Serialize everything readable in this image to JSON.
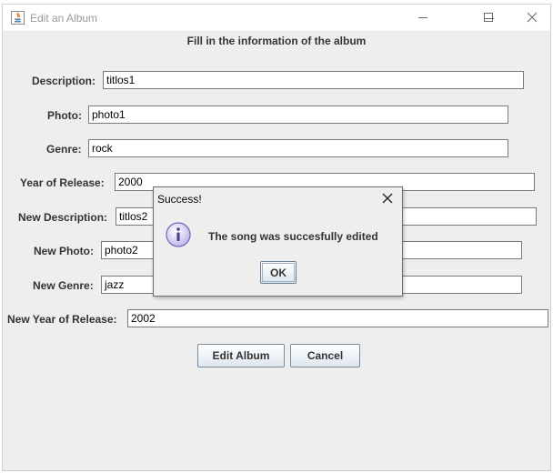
{
  "window": {
    "title": "Edit an Album",
    "controls": [
      "minimize-icon",
      "maximize-icon",
      "close-icon"
    ]
  },
  "form": {
    "heading": "Fill in the information of the album",
    "fields": [
      {
        "label": "Description:",
        "value": "titlos1"
      },
      {
        "label": "Photo:",
        "value": "photo1"
      },
      {
        "label": "Genre:",
        "value": "rock"
      },
      {
        "label": "Year of Release:",
        "value": "2000"
      },
      {
        "label": "New Description:",
        "value": "titlos2"
      },
      {
        "label": "New Photo:",
        "value": "photo2"
      },
      {
        "label": "New Genre:",
        "value": "jazz"
      },
      {
        "label": "New Year of Release:",
        "value": "2002"
      }
    ],
    "buttons": {
      "edit": "Edit Album",
      "cancel": "Cancel"
    }
  },
  "dialog": {
    "title": "Success!",
    "message": "The song was succesfully edited",
    "ok_label": "OK",
    "icon": "info-icon"
  }
}
